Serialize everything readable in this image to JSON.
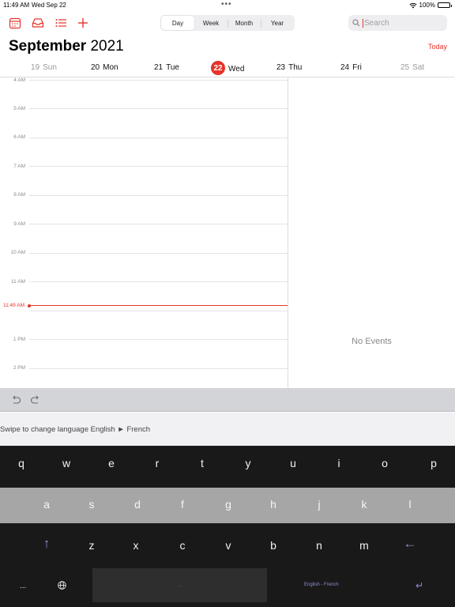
{
  "status_bar": {
    "time": "11:49 AM",
    "date": "Wed Sep 22",
    "battery": "100%",
    "battery_level": 1.0
  },
  "toolbar": {
    "icons": [
      "calendar-icon",
      "inbox-icon",
      "list-icon",
      "plus-icon"
    ],
    "views": [
      "Day",
      "Week",
      "Month",
      "Year"
    ],
    "active_view": "Day",
    "search_placeholder": "Search"
  },
  "header": {
    "month": "September",
    "year": "2021",
    "today_label": "Today"
  },
  "week": {
    "days": [
      {
        "num": "19",
        "name": "Sun"
      },
      {
        "num": "20",
        "name": "Mon"
      },
      {
        "num": "21",
        "name": "Tue"
      },
      {
        "num": "22",
        "name": "Wed"
      },
      {
        "num": "23",
        "name": "Thu"
      },
      {
        "num": "24",
        "name": "Fri"
      },
      {
        "num": "25",
        "name": "Sat"
      }
    ],
    "selected": "22"
  },
  "timeline": {
    "hours": [
      "4 AM",
      "5 AM",
      "6 AM",
      "7 AM",
      "8 AM",
      "9 AM",
      "10 AM",
      "11 AM",
      "1 PM",
      "2 PM"
    ],
    "now_label": "11:49 AM"
  },
  "events_panel": {
    "empty_text": "No Events"
  },
  "keyboard": {
    "hint": "Swipe to change language English ► French",
    "row1": [
      "q",
      "w",
      "e",
      "r",
      "t",
      "y",
      "u",
      "i",
      "o",
      "p"
    ],
    "row2": [
      "a",
      "s",
      "d",
      "f",
      "g",
      "h",
      "j",
      "k",
      "l"
    ],
    "row3": [
      "z",
      "x",
      "c",
      "v",
      "b",
      "n",
      "m"
    ],
    "shift_glyph": "↑",
    "backspace_glyph": "←",
    "mode_label": "...",
    "space_label": "...",
    "language_label": "English - French",
    "return_glyph": "↵"
  },
  "colors": {
    "accent": "#e5332a",
    "keyboard_dark": "#191919",
    "keyboard_mid": "#a6a6a6",
    "keyboard_special": "#8f8fd6"
  }
}
